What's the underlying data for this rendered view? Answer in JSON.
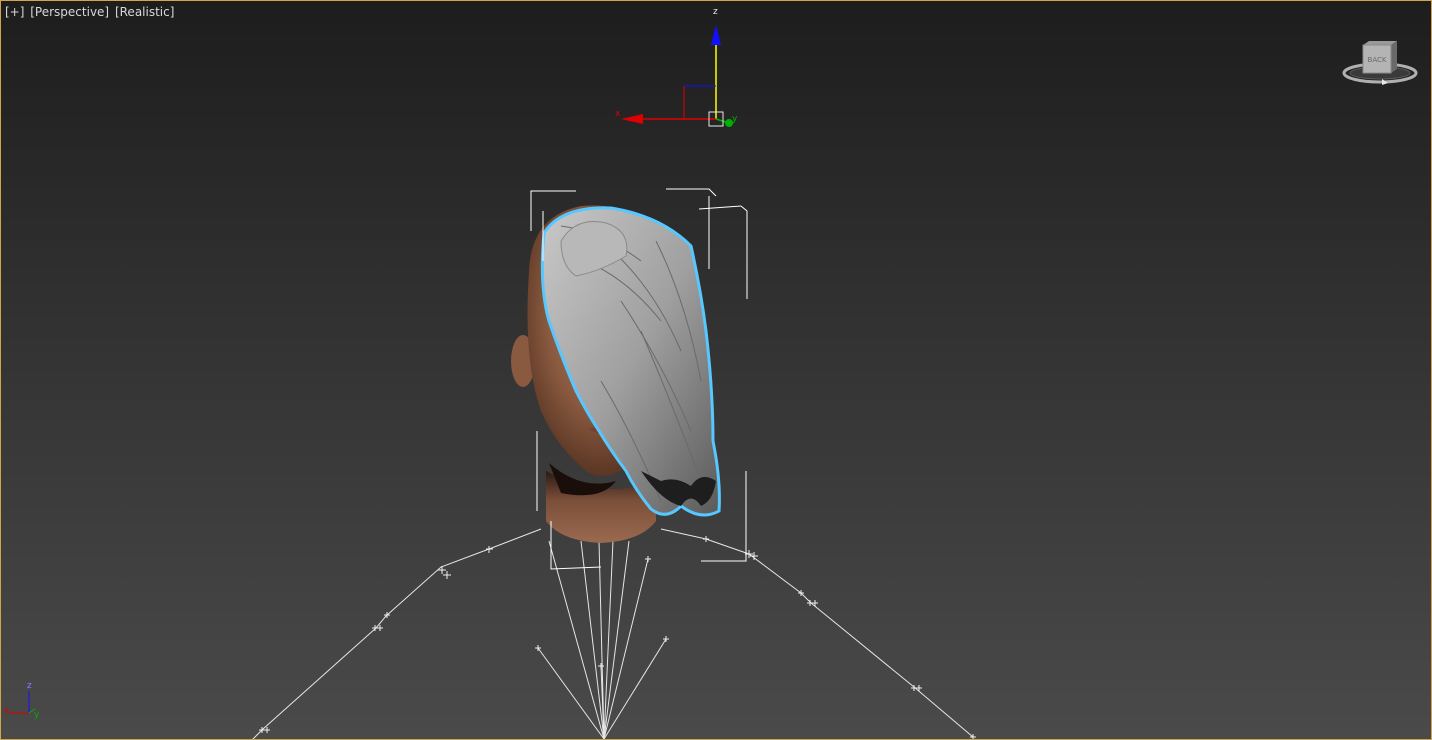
{
  "viewport": {
    "menu_label": "[+]",
    "view_label": "[Perspective]",
    "shading_label": "[Realistic]"
  },
  "gizmo": {
    "x_label": "x",
    "y_label": "y",
    "z_label": "z",
    "x_color": "#e00000",
    "y_color": "#00b000",
    "z_color": "#1010ff"
  },
  "viewcube": {
    "face_label": "BACK"
  },
  "world_axis": {
    "x_label": "x",
    "y_label": "y",
    "z_label": "z"
  },
  "selection_outline_color": "#56c8ff",
  "icons": {
    "viewcube": "viewcube-icon",
    "transform_gizmo": "move-gizmo-icon",
    "world_axis": "world-axis-icon"
  }
}
